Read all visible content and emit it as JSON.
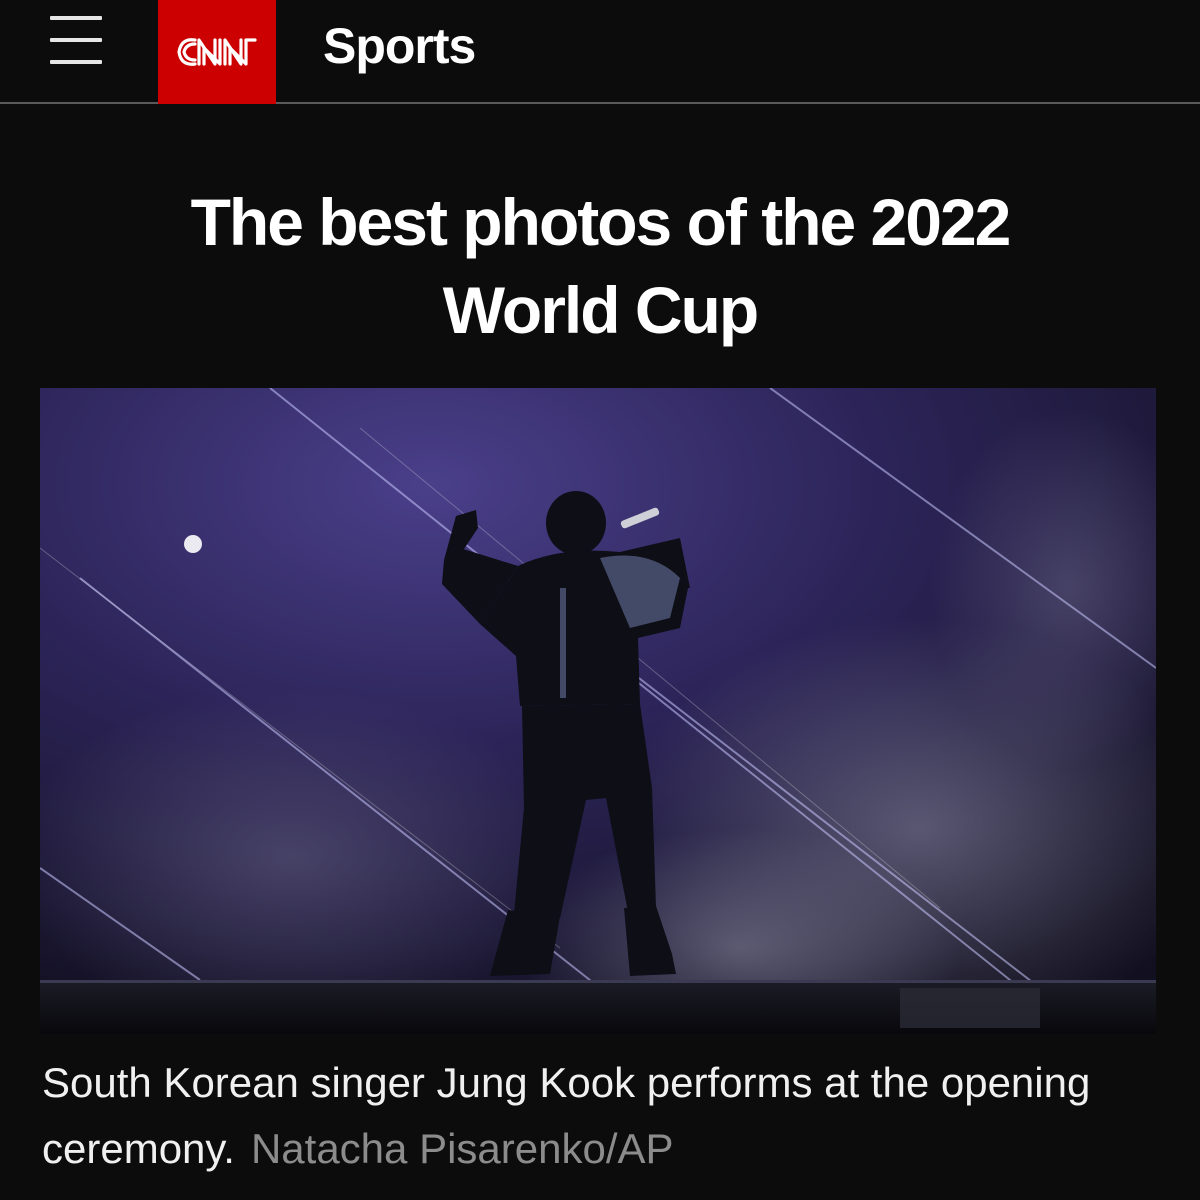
{
  "header": {
    "menu_icon": "hamburger-menu-icon",
    "logo_text": "CNN",
    "logo_color": "#cc0000",
    "section": "Sports"
  },
  "article": {
    "headline_line1": "The best photos of the 2022",
    "headline_line2": "World Cup",
    "caption": "South Korean singer Jung Kook performs at the opening ceremony.",
    "credit": "Natacha Pisarenko/AP"
  }
}
